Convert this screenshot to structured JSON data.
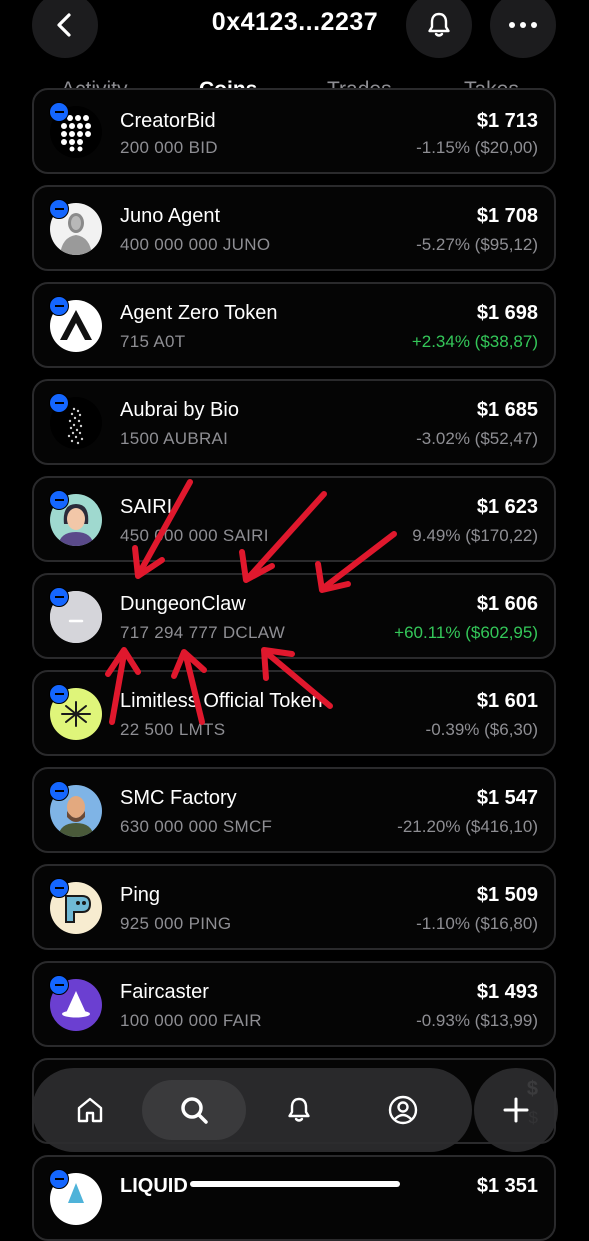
{
  "header": {
    "title": "0x4123...2237",
    "back_icon": "chevron-left-icon",
    "bell_icon": "bell-icon",
    "more_icon": "more-dots-icon"
  },
  "tabs": [
    {
      "label": "Activity"
    },
    {
      "label": "Coins"
    },
    {
      "label": "Trades"
    },
    {
      "label": "Takes"
    }
  ],
  "active_tab": "Coins",
  "coins": [
    {
      "name": "CreatorBid",
      "amount": "200 000 BID",
      "value": "$1 713",
      "change": "-1.15% ($20,00)",
      "positive": false
    },
    {
      "name": "Juno Agent",
      "amount": "400 000 000 JUNO",
      "value": "$1 708",
      "change": "-5.27% ($95,12)",
      "positive": false
    },
    {
      "name": "Agent Zero Token",
      "amount": "715 A0T",
      "value": "$1 698",
      "change": "+2.34% ($38,87)",
      "positive": true
    },
    {
      "name": "Aubrai by Bio",
      "amount": "1500 AUBRAI",
      "value": "$1 685",
      "change": "-3.02% ($52,47)",
      "positive": false
    },
    {
      "name": "SAIRI",
      "amount": "450 000 000 SAIRI",
      "value": "$1 623",
      "change": "9.49% ($170,22)",
      "positive": false
    },
    {
      "name": "DungeonClaw",
      "amount": "717 294 777 DCLAW",
      "value": "$1 606",
      "change": "+60.11% ($602,95)",
      "positive": true
    },
    {
      "name": "Limitless Official Token",
      "amount": "22 500 LMTS",
      "value": "$1 601",
      "change": "-0.39% ($6,30)",
      "positive": false
    },
    {
      "name": "SMC Factory",
      "amount": "630 000 000 SMCF",
      "value": "$1 547",
      "change": "-21.20% ($416,10)",
      "positive": false
    },
    {
      "name": "Ping",
      "amount": "925 000 PING",
      "value": "$1 509",
      "change": "-1.10% ($16,80)",
      "positive": false
    },
    {
      "name": "Faircaster",
      "amount": "100 000 000 FAIR",
      "value": "$1 493",
      "change": "-0.93% ($13,99)",
      "positive": false
    },
    {
      "name": "",
      "amount": "",
      "value": "$",
      "change": "$",
      "positive": false
    },
    {
      "name": "LIQUID",
      "amount": "",
      "value": "$1 351",
      "change": "",
      "positive": false
    }
  ],
  "bottom_nav": {
    "items": [
      {
        "icon": "home-icon"
      },
      {
        "icon": "search-icon"
      },
      {
        "icon": "bell-icon"
      },
      {
        "icon": "profile-icon"
      }
    ],
    "active": "search-icon",
    "plus_icon": "plus-icon"
  },
  "colors": {
    "background": "#000000",
    "card_border": "#2a2a2c",
    "badge": "#1466ff",
    "positive": "#34c759",
    "muted": "#8e8e93",
    "annotation_arrows": "#e0182d"
  }
}
